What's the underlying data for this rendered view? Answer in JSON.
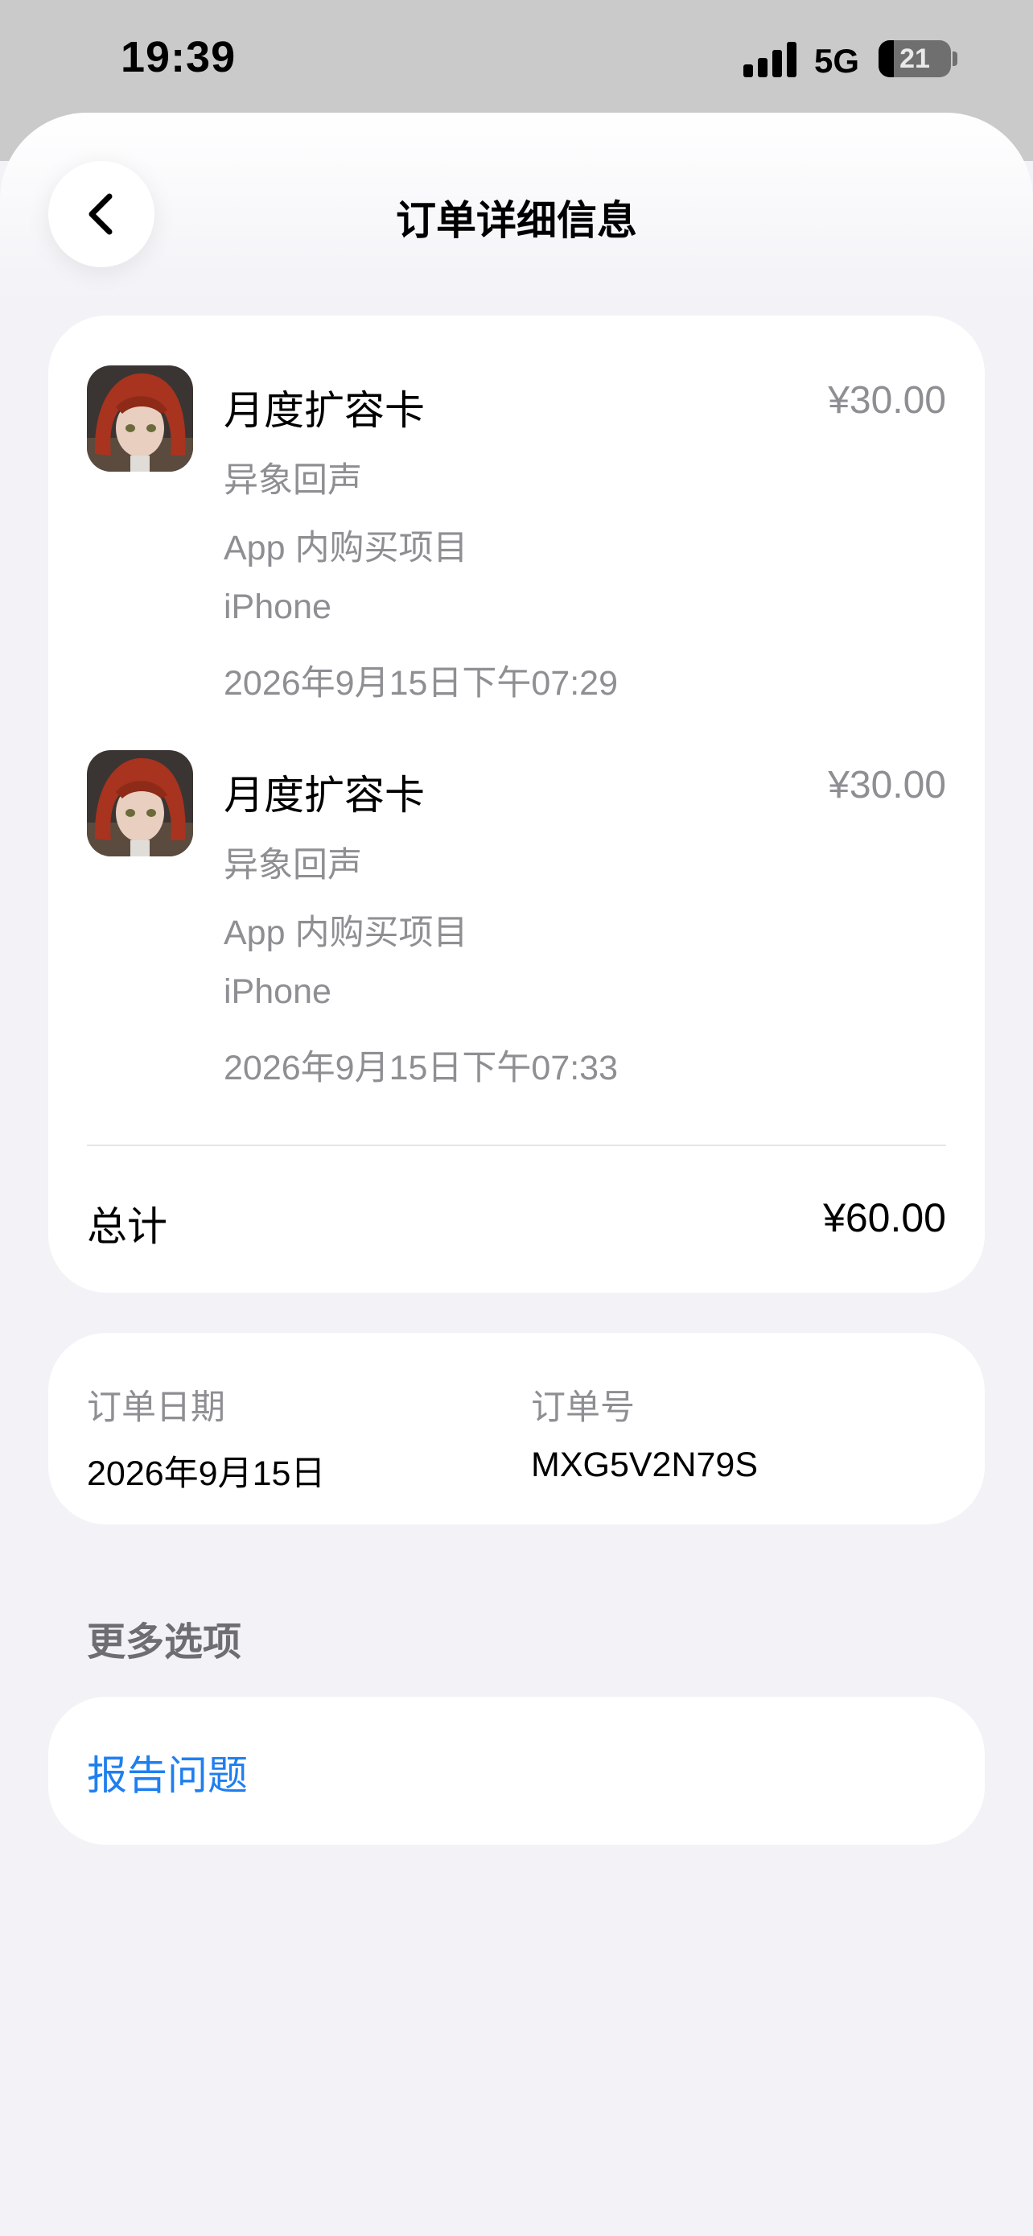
{
  "status_bar": {
    "time": "19:39",
    "network": "5G",
    "battery_level": "21",
    "icons": [
      "signal-icon",
      "battery-icon"
    ]
  },
  "nav": {
    "title": "订单详细信息",
    "back_icon": "chevron-left-icon"
  },
  "purchases": [
    {
      "title": "月度扩容卡",
      "price": "¥30.00",
      "app_name": "异象回声",
      "type": "App 内购买项目",
      "device": "iPhone",
      "datetime": "2026年9月15日下午07:29"
    },
    {
      "title": "月度扩容卡",
      "price": "¥30.00",
      "app_name": "异象回声",
      "type": "App 内购买项目",
      "device": "iPhone",
      "datetime": "2026年9月15日下午07:33"
    }
  ],
  "total": {
    "label": "总计",
    "value": "¥60.00"
  },
  "order": {
    "date_label": "订单日期",
    "date_value": "2026年9月15日",
    "number_label": "订单号",
    "number_value": "MXG5V2N79S"
  },
  "more_options": {
    "title": "更多选项",
    "report_label": "报告问题"
  },
  "colors": {
    "background": "#f2f2f7",
    "card": "#ffffff",
    "secondary_text": "#8e8e93",
    "link": "#1f7ff0",
    "status_backdrop": "#cacaca"
  }
}
